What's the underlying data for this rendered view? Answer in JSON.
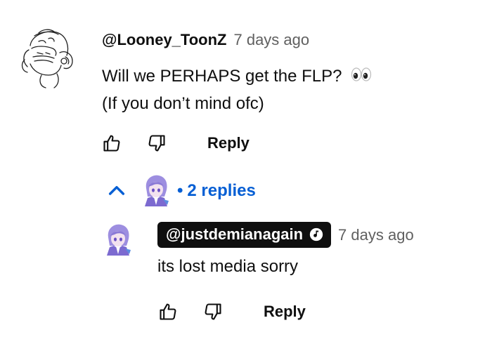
{
  "comment": {
    "author": "@Looney_ToonZ",
    "timestamp": "7 days ago",
    "text_line1": "Will we PERHAPS get the FLP?",
    "text_line2": "(If you don’t mind ofc)",
    "emoji": "eyes-emoji",
    "reply_label": "Reply"
  },
  "replies_toggle": {
    "dot": "•",
    "count_label": "2 replies",
    "avatar": "anime-avatar-purple-hair",
    "expanded": true
  },
  "reply": {
    "author": "@justdemianagain",
    "badge_icon": "music-note-check-icon",
    "timestamp": "7 days ago",
    "text": "its lost media sorry",
    "reply_label": "Reply"
  },
  "colors": {
    "link_blue": "#065fd4",
    "text": "#0f0f0f",
    "muted": "#606060",
    "badge_bg": "#0f0f0f"
  }
}
